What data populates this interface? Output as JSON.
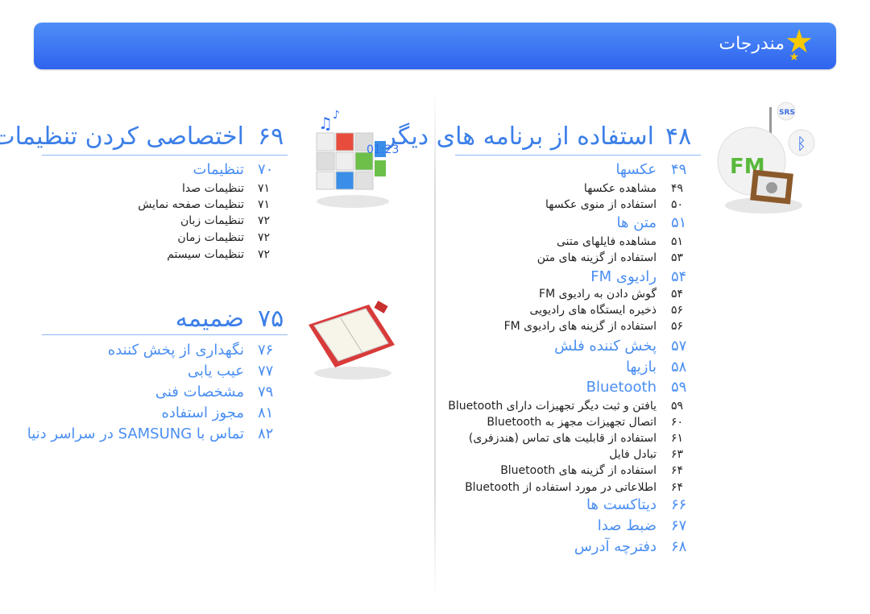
{
  "header": {
    "title": "مندرجات",
    "icon": "star-icon",
    "accent": "#3a74f0"
  },
  "right": {
    "heading": {
      "num": "۴۸",
      "label": "استفاده از برنامه های دیگر"
    },
    "items": [
      {
        "num": "۴۹",
        "label": "عکسها",
        "level": "b"
      },
      {
        "num": "۴۹",
        "label": "مشاهده عکسها",
        "level": "s"
      },
      {
        "num": "۵۰",
        "label": "استفاده از منوی عکسها",
        "level": "s"
      },
      {
        "num": "۵۱",
        "label": "متن ها",
        "level": "b"
      },
      {
        "num": "۵۱",
        "label": "مشاهده فایلهای متنی",
        "level": "s"
      },
      {
        "num": "۵۳",
        "label": "استفاده از گزینه های متن",
        "level": "s"
      },
      {
        "num": "۵۴",
        "label": "رادیوی FM",
        "level": "b"
      },
      {
        "num": "۵۴",
        "label": "گوش دادن به رادیوی FM",
        "level": "s"
      },
      {
        "num": "۵۶",
        "label": "ذخیره ایستگاه های رادیویی",
        "level": "s"
      },
      {
        "num": "۵۶",
        "label": "استفاده از گزینه های رادیوی FM",
        "level": "s"
      },
      {
        "num": "۵۷",
        "label": "پخش کننده فلش",
        "level": "b"
      },
      {
        "num": "۵۸",
        "label": "بازیها",
        "level": "b"
      },
      {
        "num": "۵۹",
        "label": "Bluetooth",
        "level": "b"
      },
      {
        "num": "۵۹",
        "label": "یافتن و ثبت دیگر تجهیزات دارای Bluetooth",
        "level": "s"
      },
      {
        "num": "۶۰",
        "label": "اتصال تجهیزات مجهز به Bluetooth",
        "level": "s"
      },
      {
        "num": "۶۱",
        "label": "استفاده از قابلیت های تماس (هندزفری)",
        "level": "s"
      },
      {
        "num": "۶۳",
        "label": "تبادل فایل",
        "level": "s"
      },
      {
        "num": "۶۴",
        "label": "استفاده از گزینه های Bluetooth",
        "level": "s"
      },
      {
        "num": "۶۴",
        "label": "اطلاعاتی در مورد استفاده از Bluetooth",
        "level": "s"
      },
      {
        "num": "۶۶",
        "label": "دیتاکست ها",
        "level": "b"
      },
      {
        "num": "۶۷",
        "label": "ضبط صدا",
        "level": "b"
      },
      {
        "num": "۶۸",
        "label": "دفترچه آدرس",
        "level": "b"
      }
    ]
  },
  "left": {
    "heading": {
      "num": "۶۹",
      "label": "اختصاصی کردن تنظیمات"
    },
    "items": [
      {
        "num": "۷۰",
        "label": "تنظیمات",
        "level": "b"
      },
      {
        "num": "۷۱",
        "label": "تنظیمات صدا",
        "level": "s"
      },
      {
        "num": "۷۱",
        "label": "تنظیمات صفحه نمایش",
        "level": "s"
      },
      {
        "num": "۷۲",
        "label": "تنظیمات زبان",
        "level": "s"
      },
      {
        "num": "۷۲",
        "label": "تنظیمات زمان",
        "level": "s"
      },
      {
        "num": "۷۲",
        "label": "تنظیمات سیستم",
        "level": "s"
      }
    ],
    "heading2": {
      "num": "۷۵",
      "label": "ضمیمه"
    },
    "items2": [
      {
        "num": "۷۶",
        "label": "نگهداری از پخش کننده",
        "level": "b"
      },
      {
        "num": "۷۷",
        "label": "عیب یابی",
        "level": "b"
      },
      {
        "num": "۷۹",
        "label": "مشخصات فنی",
        "level": "b"
      },
      {
        "num": "۸۱",
        "label": "مجوز استفاده",
        "level": "b"
      },
      {
        "num": "۸۲",
        "label": "تماس با SAMSUNG در سراسر دنیا",
        "level": "b"
      }
    ]
  },
  "art": {
    "fm_label": "FM",
    "srs_label": "SRS",
    "clock_label": "01:23"
  }
}
